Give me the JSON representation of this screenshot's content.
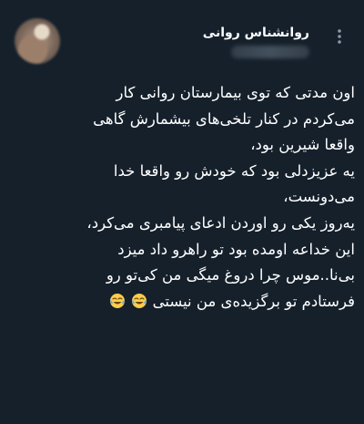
{
  "tweet": {
    "display_name": "روانشناس روانی",
    "lines": [
      "اون مدتی که توی بیمارستان روانی کار",
      "می‌کردم در کنار تلخی‌های بیشمارش گاهی",
      "واقعا شیرین بود،",
      "یه عزیزدلی بود که خودش رو واقعا خدا",
      "می‌دونست،",
      "یه‌روز یکی رو اوردن ادعای پیامبری می‌کرد،",
      "این خداعه اومده بود تو راهرو داد میزد",
      "بی‌نا..موس چرا دروغ میگی من کی‌تو رو"
    ],
    "last_line_text": "فرستادم تو برگزیده‌ی من نیستی",
    "last_line_emoji": "😂😂",
    "emoji_icon": "tears-of-joy-icon",
    "more_icon": "more-vertical-icon"
  },
  "colors": {
    "background": "#15202b",
    "text": "#ffffff",
    "secondary": "#8b98a5"
  }
}
